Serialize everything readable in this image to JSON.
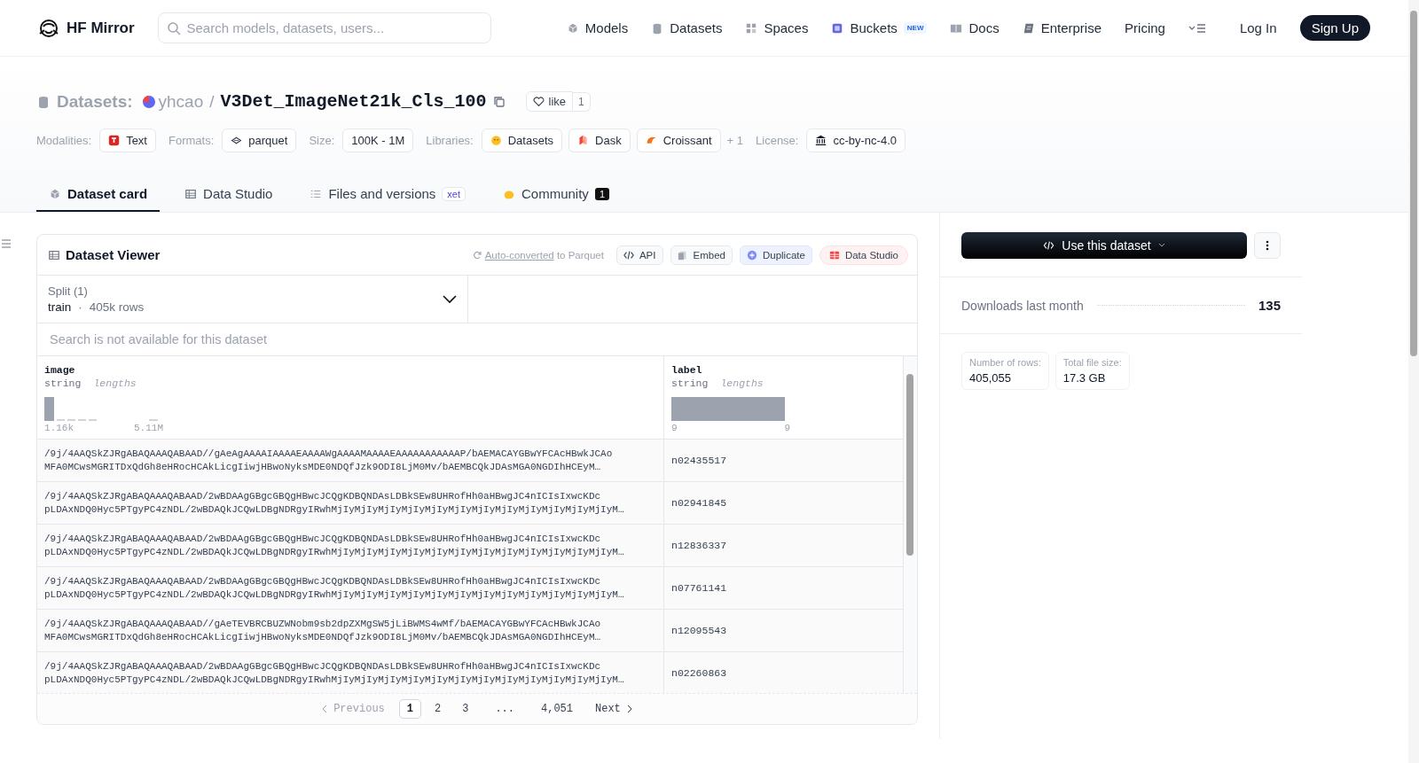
{
  "header": {
    "logo_text": "HF Mirror",
    "search": {
      "placeholder": "Search models, datasets, users..."
    },
    "nav": [
      {
        "label": "Models"
      },
      {
        "label": "Datasets"
      },
      {
        "label": "Spaces"
      },
      {
        "label": "Buckets",
        "badge": "NEW"
      },
      {
        "label": "Docs"
      },
      {
        "label": "Enterprise"
      },
      {
        "label": "Pricing"
      }
    ],
    "login": "Log In",
    "signup": "Sign Up"
  },
  "repo": {
    "section": "Datasets:",
    "owner": "yhcao",
    "separator": "/",
    "name": "V3Det_ImageNet21k_Cls_100",
    "like": "like",
    "likes": "1"
  },
  "meta": [
    {
      "label": "Modalities:",
      "tags": [
        {
          "text": "Text"
        }
      ]
    },
    {
      "label": "Formats:",
      "tags": [
        {
          "text": "parquet"
        }
      ]
    },
    {
      "label": "Size:",
      "tags": [
        {
          "text": "100K - 1M"
        }
      ]
    },
    {
      "label": "Libraries:",
      "tags": [
        {
          "text": "Datasets"
        },
        {
          "text": "Dask"
        },
        {
          "text": "Croissant"
        }
      ],
      "more": "+ 1"
    },
    {
      "label": "License:",
      "tags": [
        {
          "text": "cc-by-nc-4.0"
        }
      ]
    }
  ],
  "tabs": [
    {
      "label": "Dataset card",
      "selected": true
    },
    {
      "label": "Data Studio",
      "selected": false
    },
    {
      "label": "Files and versions",
      "selected": false,
      "badge": "xet"
    },
    {
      "label": "Community",
      "selected": false,
      "count": "1"
    }
  ],
  "viewer": {
    "title": "Dataset Viewer",
    "converted_link": "Auto-converted",
    "converted_rest": " to Parquet",
    "buttons": [
      {
        "label": "API",
        "kind": "api"
      },
      {
        "label": "Embed",
        "kind": "embed"
      },
      {
        "label": "Duplicate",
        "kind": "duplicate"
      },
      {
        "label": "Data Studio",
        "kind": "studio"
      }
    ],
    "split": {
      "label": "Split (1)",
      "value": "train",
      "separator": "·",
      "rows": "405k rows"
    },
    "search": {
      "placeholder": "Search is not available for this dataset"
    },
    "columns": [
      {
        "name": "image",
        "type": "string",
        "stat": "lengths",
        "min": "1.16k",
        "max": "5.11M"
      },
      {
        "name": "label",
        "type": "string",
        "stat": "lengths",
        "min": "9",
        "max": "9"
      }
    ],
    "rows": [
      [
        "/9j/4AAQSkZJRgABAQAAAQABAAD//gAeAgAAAAIAAAAEAAAAWgAAAAMAAAAEAAAAAAAAAAAP/bAEMACAYGBwYFCAcHBwkJCAo\nMFA0MCwsMGRITDxQdGh8eHRocHCAkLicgIiwjHBwoNyksMDE0NDQfJzk9ODI8LjM0Mv/bAEMBCQkJDAsMGA0NGDIhHCEyM…",
        "n02435517"
      ],
      [
        "/9j/4AAQSkZJRgABAQAAAQABAAD/2wBDAAgGBgcGBQgHBwcJCQgKDBQNDAsLDBkSEw8UHRofHh0aHBwgJC4nICIsIxwcKDc\npLDAxNDQ0Hyc5PTgyPC4zNDL/2wBDAQkJCQwLDBgNDRgyIRwhMjIyMjIyMjIyMjIyMjIyMjIyMjIyMjIyMjIyMjIyMjIyMjIyM…",
        "n02941845"
      ],
      [
        "/9j/4AAQSkZJRgABAQAAAQABAAD/2wBDAAgGBgcGBQgHBwcJCQgKDBQNDAsLDBkSEw8UHRofHh0aHBwgJC4nICIsIxwcKDc\npLDAxNDQ0Hyc5PTgyPC4zNDL/2wBDAQkJCQwLDBgNDRgyIRwhMjIyMjIyMjIyMjIyMjIyMjIyMjIyMjIyMjIyMjIyMjIyMjIyM…",
        "n12836337"
      ],
      [
        "/9j/4AAQSkZJRgABAQAAAQABAAD/2wBDAAgGBgcGBQgHBwcJCQgKDBQNDAsLDBkSEw8UHRofHh0aHBwgJC4nICIsIxwcKDc\npLDAxNDQ0Hyc5PTgyPC4zNDL/2wBDAQkJCQwLDBgNDRgyIRwhMjIyMjIyMjIyMjIyMjIyMjIyMjIyMjIyMjIyMjIyMjIyMjIyM…",
        "n07761141"
      ],
      [
        "/9j/4AAQSkZJRgABAQAAAQABAAD//gAeTEVBRCBUZWNobm9sb2dpZXMgSW5jLiBWMS4wMf/bAEMACAYGBwYFCAcHBwkJCAo\nMFA0MCwsMGRITDxQdGh8eHRocHCAkLicgIiwjHBwoNyksMDE0NDQfJzk9ODI8LjM0Mv/bAEMBCQkJDAsMGA0NGDIhHCEyM…",
        "n12095543"
      ],
      [
        "/9j/4AAQSkZJRgABAQAAAQABAAD/2wBDAAgGBgcGBQgHBwcJCQgKDBQNDAsLDBkSEw8UHRofHh0aHBwgJC4nICIsIxwcKDc\npLDAxNDQ0Hyc5PTgyPC4zNDL/2wBDAQkJCQwLDBgNDRgyIRwhMjIyMjIyMjIyMjIyMjIyMjIyMjIyMjIyMjIyMjIyMjIyMjIyM…",
        "n02260863"
      ]
    ],
    "pagination": {
      "previous": "Previous",
      "pages": [
        {
          "label": "1",
          "selected": true
        },
        {
          "label": "2",
          "selected": false
        },
        {
          "label": "3",
          "selected": false
        }
      ],
      "ellipsis": "...",
      "last_page": {
        "label": "4,051",
        "selected": false
      },
      "next": "Next"
    }
  },
  "sidebar": {
    "use_button": "Use this dataset",
    "downloads_label": "Downloads last month",
    "downloads": "135",
    "stats": [
      {
        "label": "Number of rows:",
        "value": "405,055"
      },
      {
        "label": "Total file size:",
        "value": "17.3 GB"
      }
    ]
  }
}
